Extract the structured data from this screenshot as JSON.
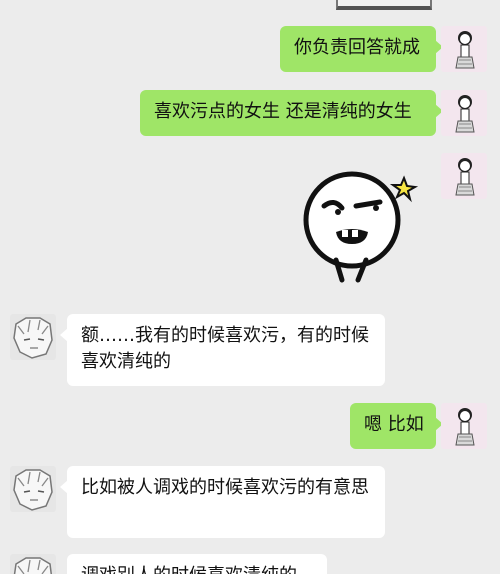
{
  "messages": [
    {
      "side": "me",
      "type": "text",
      "text": "你负责回答就成"
    },
    {
      "side": "me",
      "type": "text",
      "text": "喜欢污点的女生 还是清纯的女生"
    },
    {
      "side": "me",
      "type": "sticker",
      "sticker": "smirk-face-sticker"
    },
    {
      "side": "them",
      "type": "text",
      "text": "额……我有的时候喜欢污，有的时候喜欢清纯的"
    },
    {
      "side": "me",
      "type": "text",
      "text": "嗯 比如"
    },
    {
      "side": "them",
      "type": "text",
      "text": "比如被人调戏的时候喜欢污的有意思"
    },
    {
      "side": "them",
      "type": "text",
      "text": "调戏别人的时候喜欢清纯的"
    }
  ],
  "colors": {
    "my_bubble": "#9fe567",
    "their_bubble": "#ffffff",
    "background": "#ececec"
  }
}
